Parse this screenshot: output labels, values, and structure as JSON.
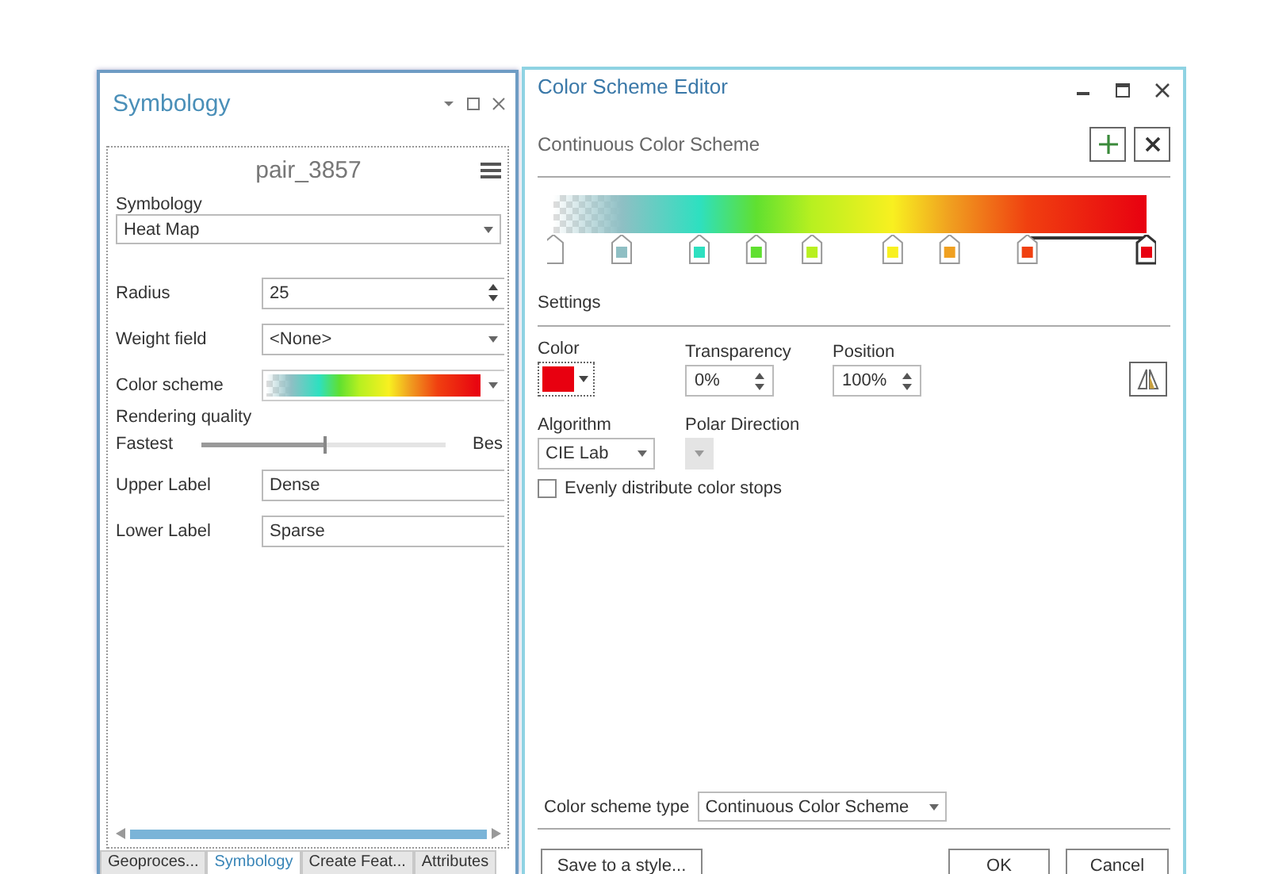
{
  "symbology_pane": {
    "title": "Symbology",
    "layer": "pair_3857",
    "symbology_label": "Symbology",
    "renderer": "Heat Map",
    "fields": [
      {
        "label": "Radius",
        "kind": "spinner",
        "value": "25"
      },
      {
        "label": "Weight field",
        "kind": "dropdown",
        "value": "<None>"
      },
      {
        "label": "Color scheme",
        "kind": "ramp"
      }
    ],
    "rendering_quality": {
      "label": "Rendering quality",
      "min_label": "Fastest",
      "max_label": "Bes",
      "level": 0.5
    },
    "labels": [
      {
        "label": "Upper Label",
        "value": "Dense"
      },
      {
        "label": "Lower Label",
        "value": "Sparse"
      }
    ],
    "tabs": [
      {
        "label": "Geoproces...",
        "selected": false
      },
      {
        "label": "Symbology",
        "selected": true
      },
      {
        "label": "Create Feat...",
        "selected": false
      },
      {
        "label": "Attributes",
        "selected": false
      }
    ]
  },
  "editor": {
    "title": "Color Scheme Editor",
    "scheme_name": "Continuous Color Scheme",
    "stops": [
      {
        "kind": "transparent",
        "level": 0,
        "selected": false
      },
      {
        "kind": "solid",
        "color": "#8fbfc4",
        "level": 0.115,
        "selected": false
      },
      {
        "kind": "solid",
        "color": "#2ee0c0",
        "level": 0.246,
        "selected": false
      },
      {
        "kind": "solid",
        "color": "#60e030",
        "level": 0.342,
        "selected": false
      },
      {
        "kind": "solid",
        "color": "#b8f020",
        "level": 0.436,
        "selected": false
      },
      {
        "kind": "solid",
        "color": "#f8f020",
        "level": 0.572,
        "selected": false
      },
      {
        "kind": "solid",
        "color": "#f0a020",
        "level": 0.668,
        "selected": false
      },
      {
        "kind": "solid",
        "color": "#f04010",
        "level": 0.799,
        "selected": false
      },
      {
        "kind": "solid",
        "color": "#e80010",
        "level": 1,
        "selected": true
      }
    ],
    "settings": {
      "heading": "Settings",
      "color": {
        "label": "Color"
      },
      "transparency": {
        "label": "Transparency",
        "value": "0%"
      },
      "position": {
        "label": "Position",
        "value": "100%"
      },
      "algorithm": {
        "label": "Algorithm",
        "value": "CIE Lab"
      },
      "polar_direction": {
        "label": "Polar Direction",
        "disabled": true
      },
      "evenly_distribute": {
        "label": "Evenly distribute color stops",
        "checked": false
      }
    },
    "scheme_type": {
      "label": "Color scheme type",
      "value": "Continuous Color Scheme"
    },
    "buttons": [
      "Save to a style...",
      "OK",
      "Cancel"
    ]
  }
}
